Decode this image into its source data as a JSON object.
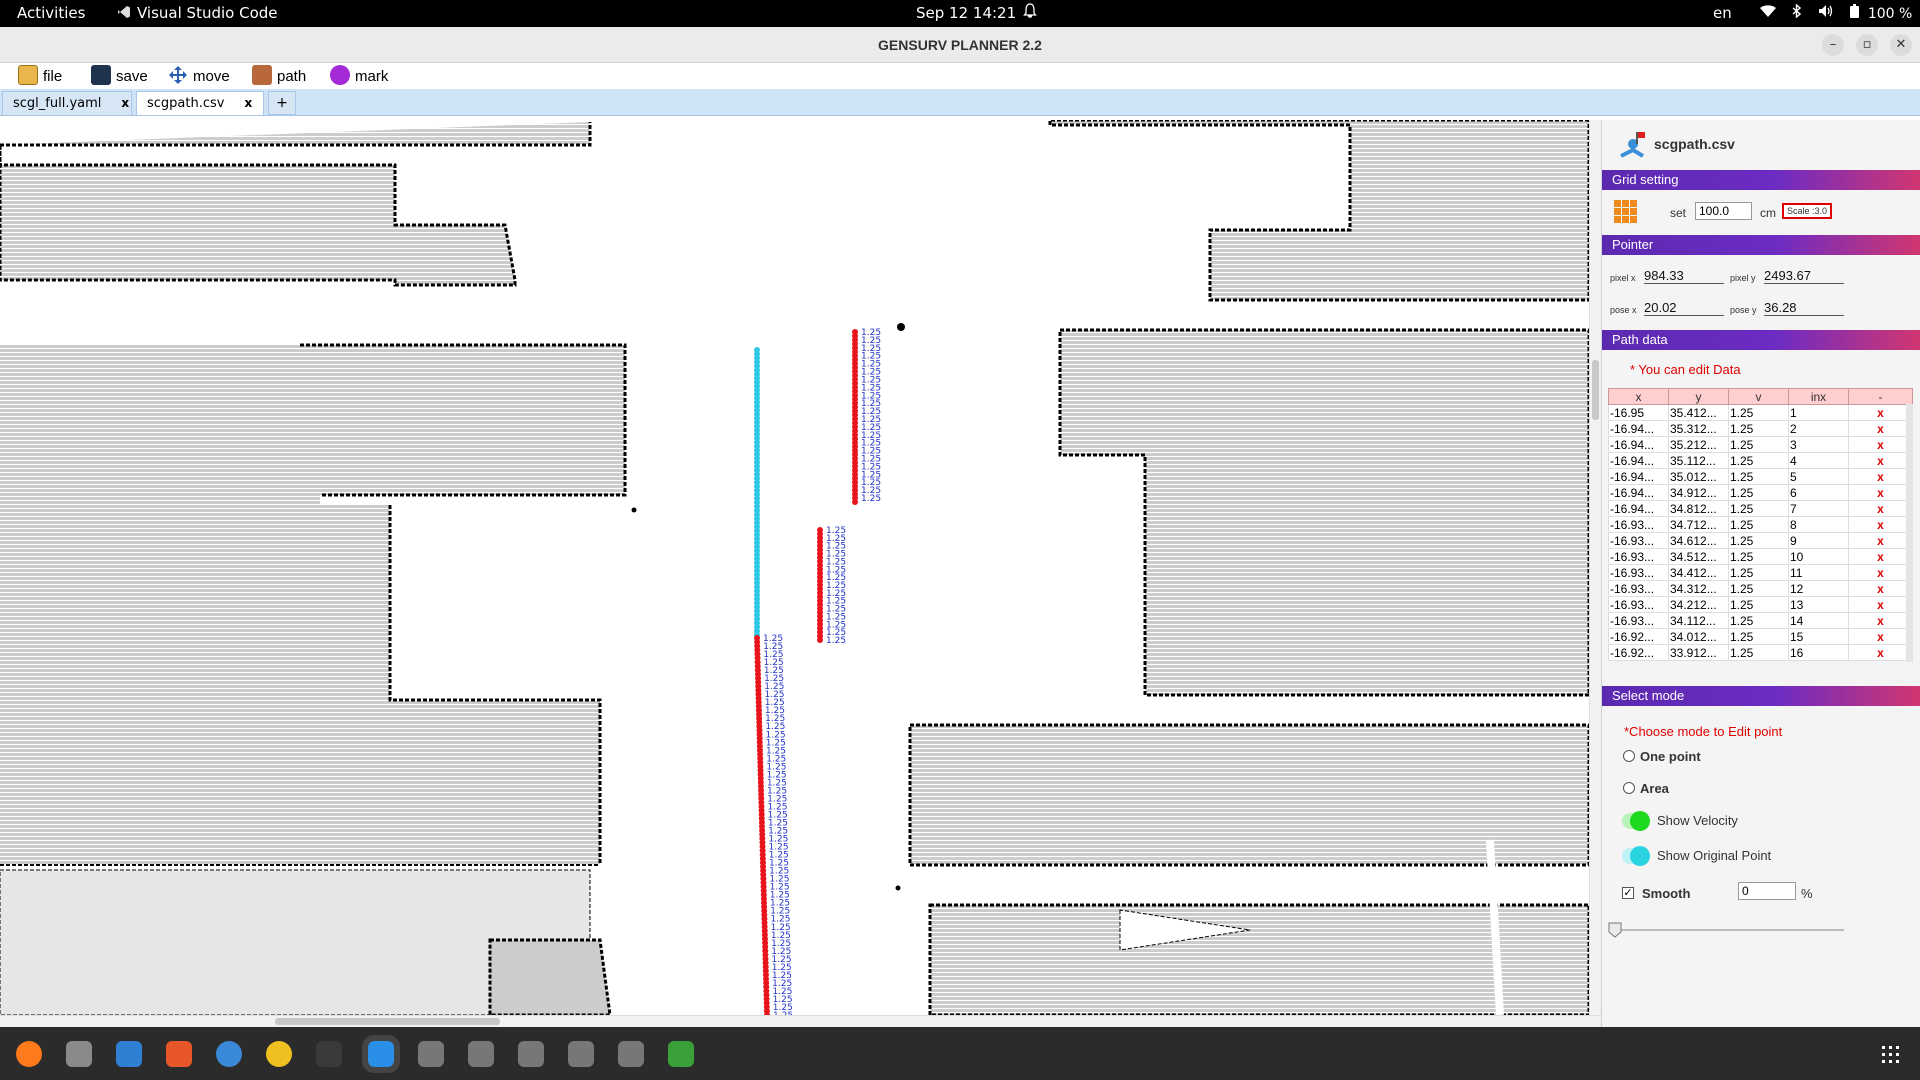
{
  "system": {
    "activities": "Activities",
    "app_name": "Visual Studio Code",
    "datetime": "Sep 12  14:21",
    "language": "en",
    "battery": "100 %"
  },
  "window": {
    "title": "GENSURV PLANNER 2.2"
  },
  "menu": {
    "file": "file",
    "save": "save",
    "move": "move",
    "path": "path",
    "mark": "mark"
  },
  "tabs": [
    {
      "label": "scgl_full.yaml",
      "close": "x"
    },
    {
      "label": "scgpath.csv",
      "close": "x"
    }
  ],
  "tab_add": "+",
  "panel": {
    "filename": "scgpath.csv",
    "grid": {
      "header": "Grid setting",
      "set_label": "set",
      "value": "100.0",
      "unit": "cm",
      "scale": "Scale :3.0"
    },
    "pointer": {
      "header": "Pointer",
      "pixel_x_label": "pixel x",
      "pixel_x": "984.33",
      "pixel_y_label": "pixel y",
      "pixel_y": "2493.67",
      "pose_x_label": "pose x",
      "pose_x": "20.02",
      "pose_y_label": "pose y",
      "pose_y": "36.28"
    },
    "path_data": {
      "header": "Path data",
      "note": "* You can edit Data",
      "columns": [
        "x",
        "y",
        "v",
        "inx",
        "-"
      ],
      "rows": [
        [
          "-16.95",
          "35.412...",
          "1.25",
          "1",
          "x"
        ],
        [
          "-16.94...",
          "35.312...",
          "1.25",
          "2",
          "x"
        ],
        [
          "-16.94...",
          "35.212...",
          "1.25",
          "3",
          "x"
        ],
        [
          "-16.94...",
          "35.112...",
          "1.25",
          "4",
          "x"
        ],
        [
          "-16.94...",
          "35.012...",
          "1.25",
          "5",
          "x"
        ],
        [
          "-16.94...",
          "34.912...",
          "1.25",
          "6",
          "x"
        ],
        [
          "-16.94...",
          "34.812...",
          "1.25",
          "7",
          "x"
        ],
        [
          "-16.93...",
          "34.712...",
          "1.25",
          "8",
          "x"
        ],
        [
          "-16.93...",
          "34.612...",
          "1.25",
          "9",
          "x"
        ],
        [
          "-16.93...",
          "34.512...",
          "1.25",
          "10",
          "x"
        ],
        [
          "-16.93...",
          "34.412...",
          "1.25",
          "11",
          "x"
        ],
        [
          "-16.93...",
          "34.312...",
          "1.25",
          "12",
          "x"
        ],
        [
          "-16.93...",
          "34.212...",
          "1.25",
          "13",
          "x"
        ],
        [
          "-16.93...",
          "34.112...",
          "1.25",
          "14",
          "x"
        ],
        [
          "-16.92...",
          "34.012...",
          "1.25",
          "15",
          "x"
        ],
        [
          "-16.92...",
          "33.912...",
          "1.25",
          "16",
          "x"
        ]
      ]
    },
    "select_mode": {
      "header": "Select mode",
      "note": "*Choose mode to Edit point",
      "one_point": "One point",
      "area": "Area",
      "show_velocity": "Show Velocity",
      "show_original": "Show Original Point",
      "smooth": "Smooth",
      "smooth_value": "0",
      "smooth_unit": "%",
      "smooth_checked": true,
      "slider_value": 0
    }
  },
  "map": {
    "velocity_label": "1.25",
    "colors": {
      "path": "#e8141c",
      "original": "#2ec8e6",
      "velocity_text": "#2233cc",
      "occupied": "#000000",
      "unknown": "#cccccc"
    }
  },
  "colors": {
    "section_start": "#5b2ab0",
    "section_end": "#d2366f",
    "velocity_toggle": "#1ed81e",
    "original_toggle": "#29d3e0"
  },
  "dock_icons": [
    "firefox-icon",
    "files-icon",
    "writer-icon",
    "software-icon",
    "help-icon",
    "chrome-icon",
    "terminal-icon",
    "vscode-icon",
    "usb-icon",
    "disc-icon",
    "disc-icon",
    "disc-icon",
    "disc-icon",
    "trash-icon"
  ]
}
